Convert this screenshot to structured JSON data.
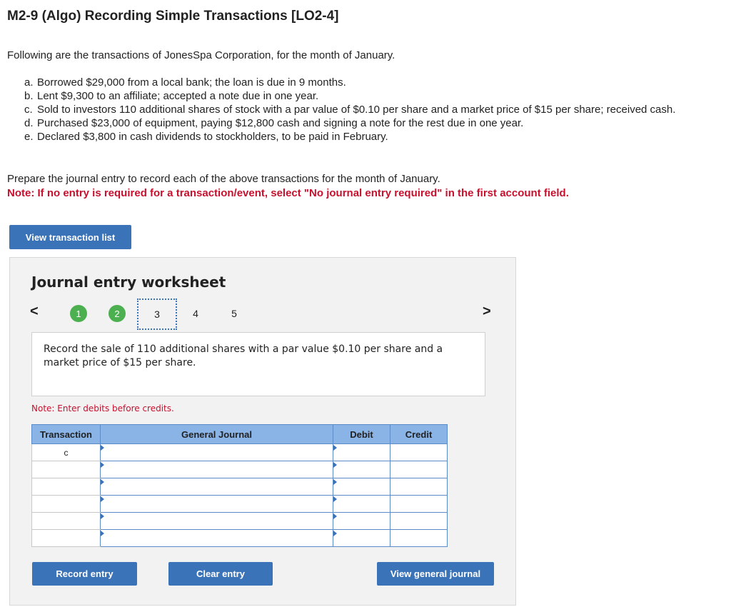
{
  "header": {
    "title": "M2-9 (Algo) Recording Simple Transactions [LO2-4]"
  },
  "intro": "Following are the transactions of JonesSpa Corporation, for the month of January.",
  "transactions": [
    {
      "letter": "a.",
      "text": "Borrowed $29,000 from a local bank; the loan is due in 9 months."
    },
    {
      "letter": "b.",
      "text": "Lent $9,300 to an affiliate; accepted a note due in one year."
    },
    {
      "letter": "c.",
      "text": "Sold to investors 110 additional shares of stock with a par value of $0.10 per share and a market price of $15 per share; received cash."
    },
    {
      "letter": "d.",
      "text": "Purchased $23,000 of equipment, paying $12,800 cash and signing a note for the rest due in one year."
    },
    {
      "letter": "e.",
      "text": "Declared $3,800 in cash dividends to stockholders, to be paid in February."
    }
  ],
  "prepare_text": "Prepare the journal entry to record each of the above transactions for the month of January.",
  "note_text": "Note: If no entry is required for a transaction/event, select \"No journal entry required\" in the first account field.",
  "buttons": {
    "view_transaction_list": "View transaction list",
    "record_entry": "Record entry",
    "clear_entry": "Clear entry",
    "view_general_journal": "View general journal"
  },
  "worksheet": {
    "title": "Journal entry worksheet",
    "nav": {
      "prev": "<",
      "next": ">"
    },
    "steps": [
      "1",
      "2",
      "3",
      "4",
      "5"
    ],
    "current_step": "3",
    "instruction": "Record the sale of 110 additional shares with a par value $0.10 per share and a market price of $15 per share.",
    "debit_note": "Note: Enter debits before credits.",
    "table": {
      "headers": {
        "transaction": "Transaction",
        "general_journal": "General Journal",
        "debit": "Debit",
        "credit": "Credit"
      },
      "rows": [
        {
          "transaction": "c"
        },
        {
          "transaction": ""
        },
        {
          "transaction": ""
        },
        {
          "transaction": ""
        },
        {
          "transaction": ""
        },
        {
          "transaction": ""
        }
      ]
    }
  },
  "colors": {
    "button_blue": "#3b73b9",
    "header_blue": "#8ab3e6",
    "note_red": "#c8102e",
    "step_green": "#4caf50"
  }
}
